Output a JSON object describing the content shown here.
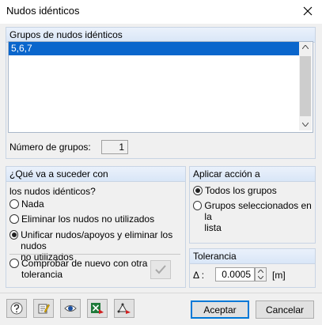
{
  "window": {
    "title": "Nudos idénticos"
  },
  "groups": {
    "header": "Grupos de nudos idénticos",
    "items": [
      "5,6,7"
    ],
    "count_label": "Número de grupos:",
    "count_value": "1"
  },
  "what": {
    "header": "¿Qué va a suceder con",
    "subtitle": "los nudos idénticos?",
    "opt_none": "Nada",
    "opt_delete": "Eliminar los nudos no utilizados",
    "opt_unify_1": "Unificar nudos/apoyos y eliminar los nudos",
    "opt_unify_2": "no utilizados",
    "opt_check_1": "Comprobar de nuevo con otra",
    "opt_check_2": "tolerancia",
    "selected": "unify"
  },
  "apply": {
    "header": "Aplicar acción a",
    "opt_all": "Todos los grupos",
    "opt_sel_1": "Grupos seleccionados en la",
    "opt_sel_2": "lista"
  },
  "tolerance": {
    "header": "Tolerancia",
    "symbol": "Δ :",
    "value": "0.0005",
    "unit": "[m]"
  },
  "buttons": {
    "accept": "Aceptar",
    "cancel": "Cancelar"
  },
  "icons": [
    "help-icon",
    "edit-icon",
    "view-icon",
    "excel-export-icon",
    "nodes-icon"
  ],
  "colors": {
    "selection": "#0a66cc",
    "panel_border": "#c8d4e4",
    "accent": "#0078d7"
  }
}
